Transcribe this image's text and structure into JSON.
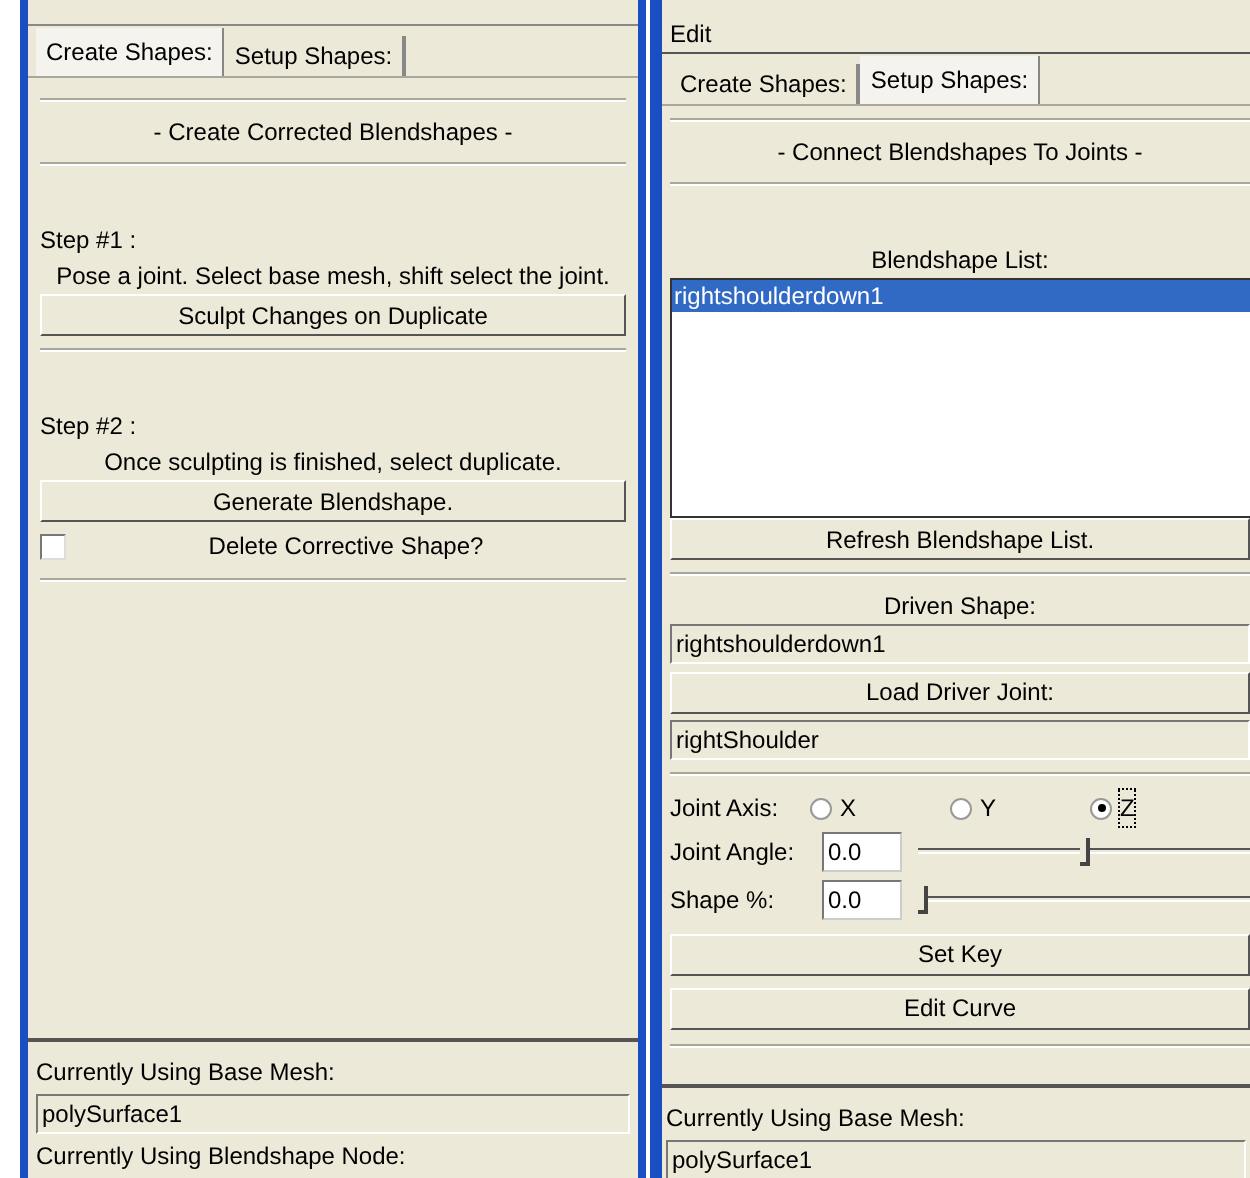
{
  "left_panel": {
    "tabs": [
      {
        "label": "Create Shapes:",
        "selected": true
      },
      {
        "label": "Setup Shapes:",
        "selected": false
      }
    ],
    "heading": "- Create Corrected Blendshapes -",
    "steps": [
      {
        "label": "Step #1 :",
        "instruction": "Pose a joint. Select base mesh, shift select the joint.",
        "button": "Sculpt Changes on Duplicate"
      },
      {
        "label": "Step #2 :",
        "instruction": "Once sculpting is finished, select duplicate.",
        "button": "Generate Blendshape."
      }
    ],
    "checkbox": {
      "label": "Delete Corrective Shape?",
      "checked": false
    },
    "base_mesh_label": "Currently Using Base Mesh:",
    "base_mesh_value": "polySurface1",
    "node_label": "Currently Using Blendshape Node:"
  },
  "right_panel": {
    "menu": [
      "Edit"
    ],
    "tabs": [
      {
        "label": "Create Shapes:",
        "selected": false
      },
      {
        "label": "Setup Shapes:",
        "selected": true
      }
    ],
    "heading": "- Connect Blendshapes To Joints -",
    "list_label": "Blendshape List:",
    "blendshape_list": [
      {
        "label": "rightshoulderdown1",
        "selected": true
      }
    ],
    "refresh_button": "Refresh Blendshape List.",
    "driven_shape_label": "Driven Shape:",
    "driven_shape_value": "rightshoulderdown1",
    "load_driver_button": "Load Driver Joint:",
    "driver_joint_value": "rightShoulder",
    "joint_axis": {
      "label": "Joint Axis:",
      "options": [
        {
          "label": "X",
          "selected": false
        },
        {
          "label": "Y",
          "selected": false
        },
        {
          "label": "Z",
          "selected": true
        }
      ]
    },
    "sliders": [
      {
        "label": "Joint Angle:",
        "value": "0.0",
        "level": 0.5
      },
      {
        "label": "Shape %:",
        "value": "0.0",
        "level": 0
      }
    ],
    "buttons": [
      "Set Key",
      "Edit Curve"
    ],
    "base_mesh_label": "Currently Using Base Mesh:",
    "base_mesh_value": "polySurface1"
  }
}
